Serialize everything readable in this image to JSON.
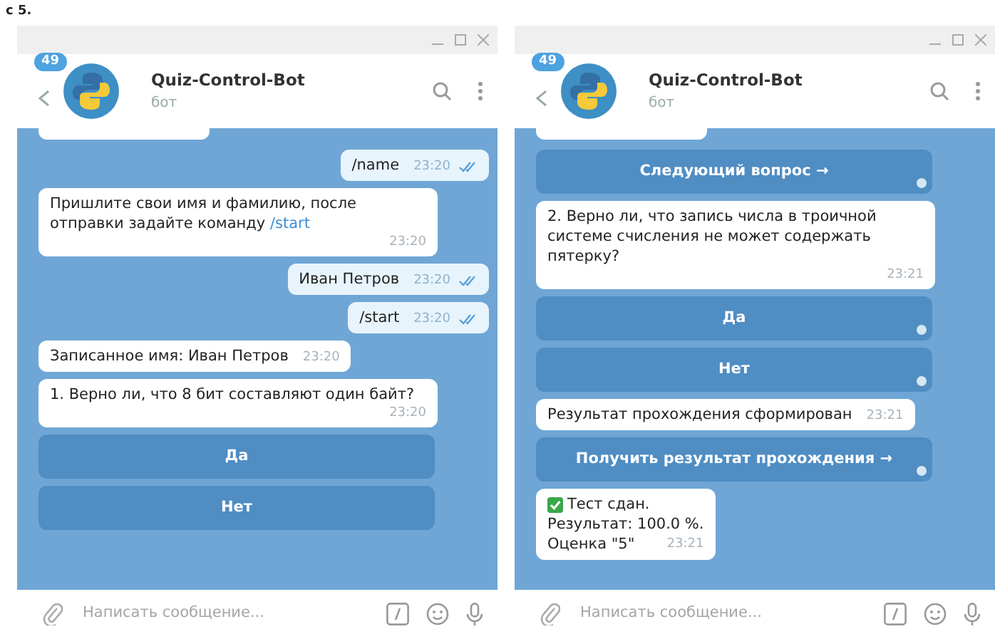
{
  "caption": "с 5.",
  "windows": [
    {
      "title": "Quiz-Control-Bot",
      "subtitle": "бот",
      "badge": "49",
      "messages": [
        {
          "kind": "cut"
        },
        {
          "kind": "out",
          "text": "/name",
          "time": "23:20",
          "read": true
        },
        {
          "kind": "in",
          "text": "Пришлите свои имя и фамилию, после отправки задайте команду ",
          "link": "/start",
          "time": "23:20"
        },
        {
          "kind": "out",
          "text": "Иван Петров",
          "time": "23:20",
          "read": true
        },
        {
          "kind": "out",
          "text": "/start",
          "time": "23:20",
          "read": true
        },
        {
          "kind": "in",
          "text": "Записанное имя: Иван Петров",
          "time": "23:20"
        },
        {
          "kind": "in",
          "text": "1. Верно ли, что 8 бит составляют один байт?",
          "time": "23:20"
        },
        {
          "kind": "button",
          "text": "Да",
          "dot": false
        },
        {
          "kind": "button",
          "text": "Нет",
          "dot": false
        }
      ],
      "composer": {
        "placeholder": "Написать сообщение..."
      }
    },
    {
      "title": "Quiz-Control-Bot",
      "subtitle": "бот",
      "badge": "49",
      "messages": [
        {
          "kind": "cut"
        },
        {
          "kind": "button",
          "text": "Следующий вопрос →",
          "dot": true
        },
        {
          "kind": "in",
          "text": "2. Верно ли, что запись числа в троичной системе счисления не может содержать пятерку?",
          "time": "23:21"
        },
        {
          "kind": "button",
          "text": "Да",
          "dot": true
        },
        {
          "kind": "button",
          "text": "Нет",
          "dot": true
        },
        {
          "kind": "in",
          "text": "Результат прохождения сформирован",
          "time": "23:21"
        },
        {
          "kind": "button",
          "text": "Получить результат прохождения →",
          "dot": true
        },
        {
          "kind": "result",
          "lines": [
            "Тест сдан.",
            "Результат: 100.0 %.",
            "Оценка \"5\""
          ],
          "time": "23:21"
        }
      ],
      "composer": {
        "placeholder": "Написать сообщение..."
      }
    }
  ]
}
